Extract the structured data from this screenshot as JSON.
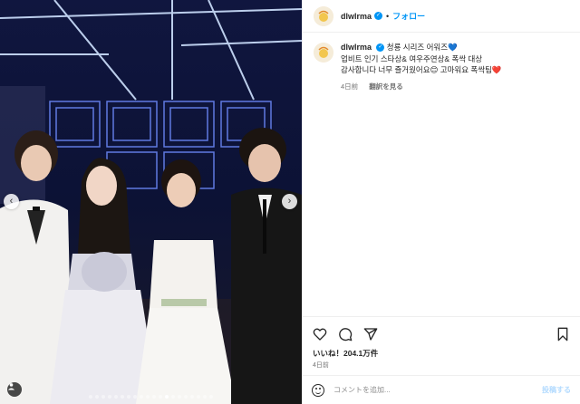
{
  "post": {
    "username": "dlwlrma",
    "separator": "•",
    "follow_label": "フォロー",
    "caption_lines": [
      "청룡 시리즈 어워즈💙",
      "업비트 인기 스타상& 여우주연상& 폭싹 대상",
      "감사합니다 너무 즐거웠어요😊 고마워요 폭싹팀❤️"
    ],
    "caption_time": "4日前",
    "translate_label": "翻訳を見る",
    "likes_text": "いいね！204.1万件",
    "date_text": "4日前",
    "comment_placeholder": "コメントを追加...",
    "post_label": "投稿する"
  },
  "carousel": {
    "prev_arrow": "‹",
    "next_arrow": "›",
    "slide_count": 20,
    "active_index": 12,
    "tag_icon": "person-tag-icon"
  },
  "icons": {
    "like": "heart-icon",
    "comment": "comment-icon",
    "share": "share-icon",
    "save": "bookmark-icon",
    "emoji": "emoji-icon"
  },
  "colors": {
    "accent": "#0095f6",
    "muted": "#737373",
    "post_disabled": "#b3dbff"
  }
}
